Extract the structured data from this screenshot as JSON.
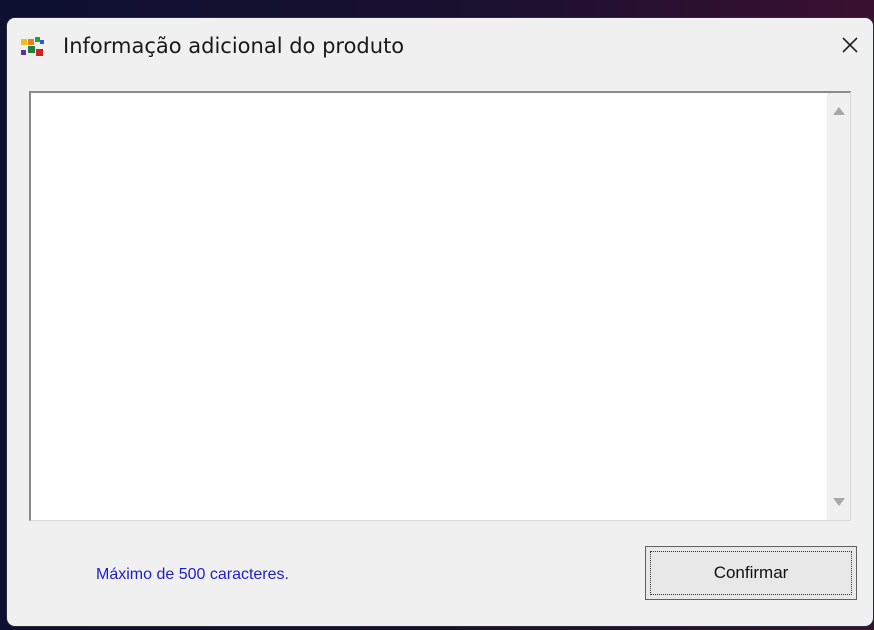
{
  "window": {
    "title": "Informação adicional do produto",
    "app_icon": "colored-blocks-icon",
    "close_icon": "close-icon"
  },
  "editor": {
    "value": "",
    "placeholder": "",
    "scroll_up_icon": "triangle-up-icon",
    "scroll_down_icon": "triangle-down-icon"
  },
  "footer": {
    "max_label": "Máximo de 500 caracteres.",
    "confirm_label": "Confirmar"
  },
  "colors": {
    "hint_text": "#1f1fc8",
    "window_bg": "#f0f0f0"
  }
}
